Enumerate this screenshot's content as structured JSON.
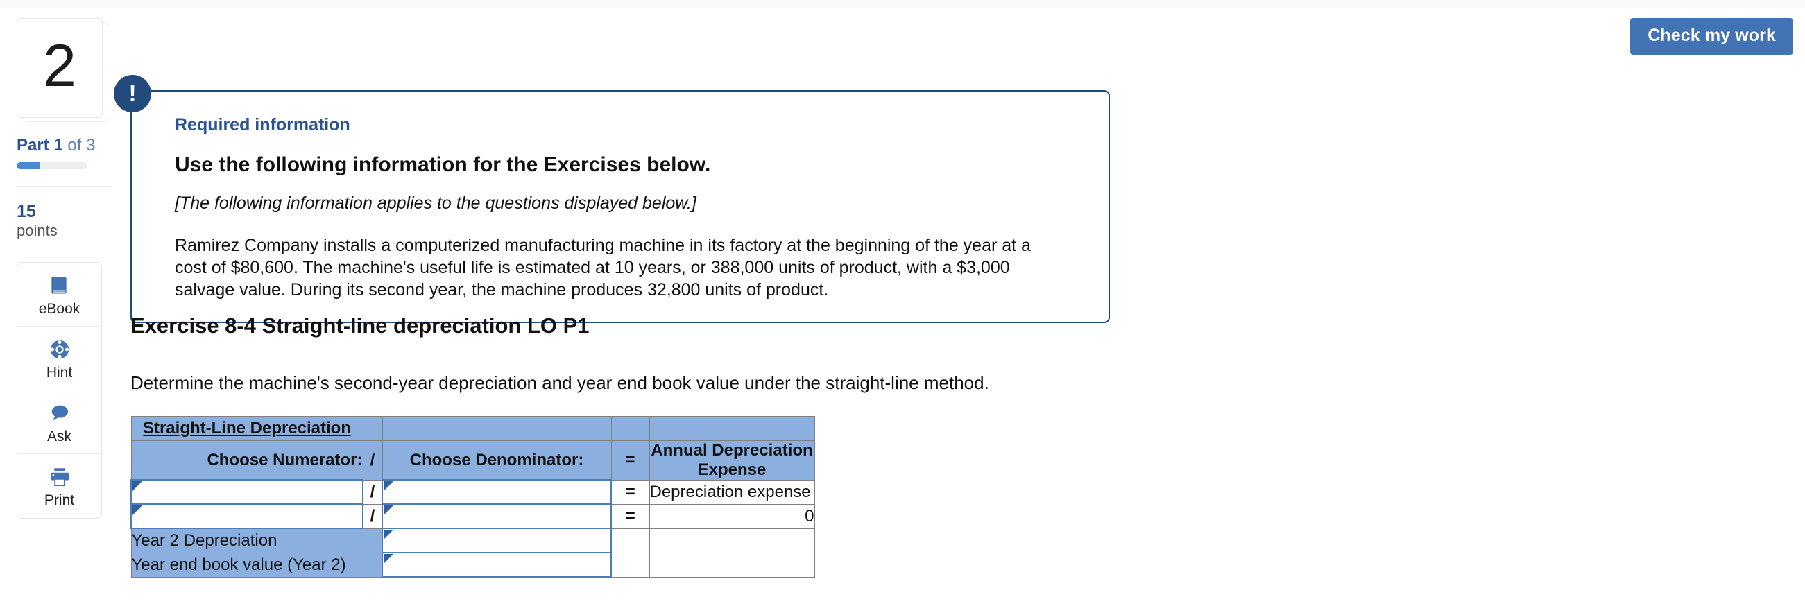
{
  "header": {
    "check_button_label": "Check my work"
  },
  "sidebar": {
    "question_number": "2",
    "part_prefix": "Part",
    "part_current": "1",
    "part_of": "of",
    "part_total": "3",
    "progress_percent": 33,
    "points_value": "15",
    "points_unit": "points",
    "tools": [
      {
        "icon": "ebook-icon",
        "label": "eBook"
      },
      {
        "icon": "lifering-hint-icon",
        "label": "Hint"
      },
      {
        "icon": "speech-bubble-ask-icon",
        "label": "Ask"
      },
      {
        "icon": "printer-icon",
        "label": "Print"
      }
    ]
  },
  "alert": {
    "badge_glyph": "!",
    "kicker": "Required information",
    "heading": "Use the following information for the Exercises below.",
    "italic_note": "[The following information applies to the questions displayed below.]",
    "body": "Ramirez Company installs a computerized manufacturing machine in its factory at the beginning of the year at a cost of $80,600. The machine's useful life is estimated at 10 years, or 388,000 units of product, with a $3,000 salvage value. During its second year, the machine produces 32,800 units of product."
  },
  "exercise": {
    "title": "Exercise 8-4 Straight-line depreciation LO P1",
    "prompt": "Determine the machine's second-year depreciation and year end book value under the straight-line method."
  },
  "worksheet": {
    "title": "Straight-Line Depreciation",
    "headers": {
      "numerator": "Choose Numerator:",
      "divide": "/",
      "denominator": "Choose Denominator:",
      "equals": "=",
      "result": "Annual Depreciation Expense"
    },
    "rows": [
      {
        "kind": "formula",
        "numerator": "",
        "op1": "/",
        "denominator": "",
        "op2": "=",
        "result": "Depreciation expense"
      },
      {
        "kind": "formula",
        "numerator": "",
        "op1": "/",
        "denominator": "",
        "op2": "=",
        "result": "0"
      },
      {
        "kind": "label",
        "label": "Year 2 Depreciation",
        "value": "",
        "op2": "",
        "result": ""
      },
      {
        "kind": "label",
        "label": "Year end book value (Year 2)",
        "value": "",
        "op2": "",
        "result": ""
      }
    ]
  },
  "colors": {
    "accent_blue": "#4273b5",
    "dark_navy": "#234a7d",
    "table_header_blue": "#8bb0e0",
    "input_border_blue": "#4a7ebb"
  }
}
